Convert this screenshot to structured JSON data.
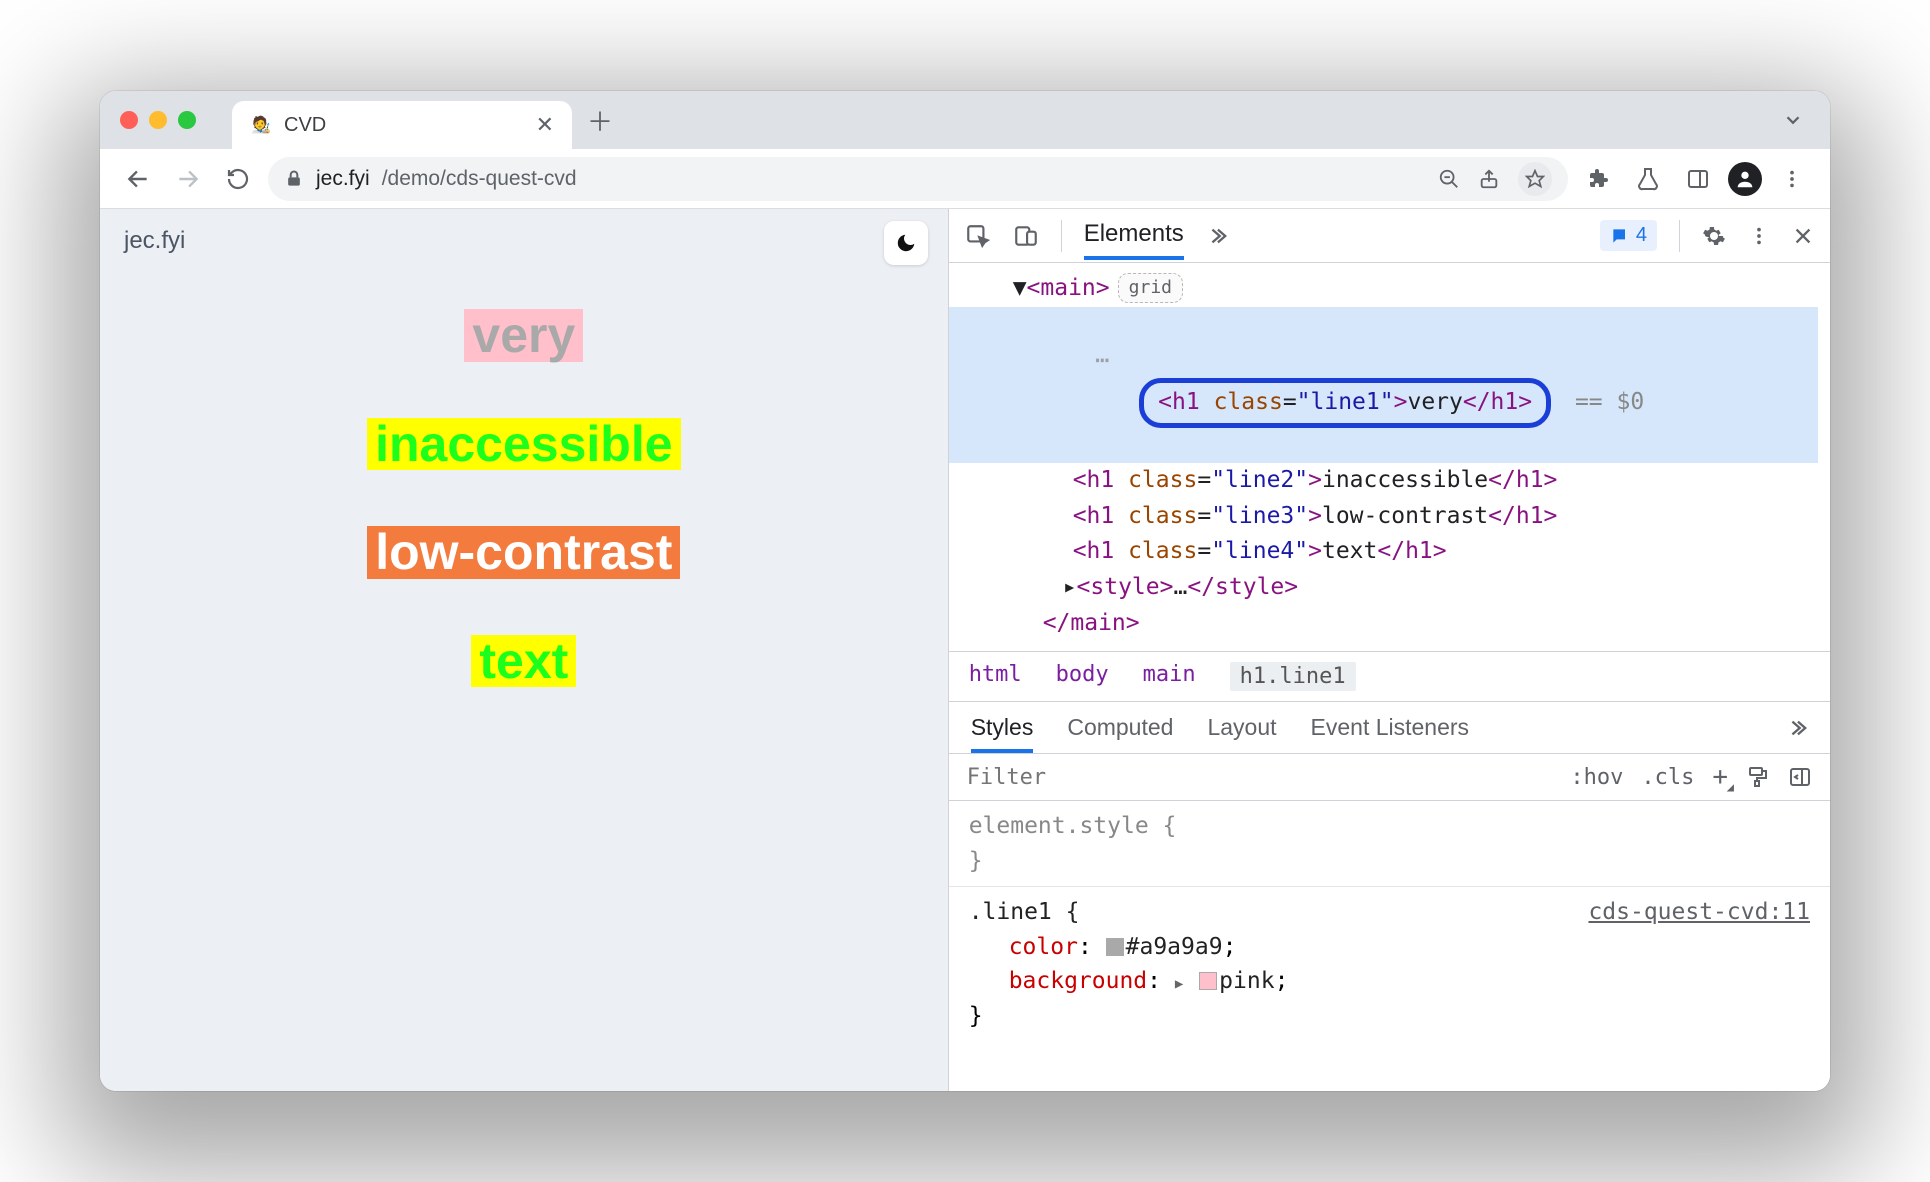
{
  "tab": {
    "title": "CVD",
    "favicon_emoji": "🧑‍🎨"
  },
  "url": {
    "host": "jec.fyi",
    "path": "/demo/cds-quest-cvd"
  },
  "page": {
    "logo": "jec.fyi",
    "lines": {
      "l1": "very",
      "l2": "inaccessible",
      "l3": "low-contrast",
      "l4": "text"
    }
  },
  "devtools": {
    "panel": "Elements",
    "issues_count": "4",
    "dom": {
      "main_open": "<main>",
      "main_badge": "grid",
      "h1_line1": {
        "open": "<h1 class=\"line1\">",
        "text": "very",
        "close": "</h1>",
        "suffix": " == $0"
      },
      "h1_line2": {
        "open": "<h1 class=\"line2\">",
        "text": "inaccessible",
        "close": "</h1>"
      },
      "h1_line3": {
        "open": "<h1 class=\"line3\">",
        "text": "low-contrast",
        "close": "</h1>"
      },
      "h1_line4": {
        "open": "<h1 class=\"line4\">",
        "text": "text",
        "close": "</h1>"
      },
      "style_open": "<style>",
      "style_ell": "…",
      "style_close": "</style>",
      "main_close": "</main>"
    },
    "crumbs": [
      "html",
      "body",
      "main",
      "h1.line1"
    ],
    "panes": [
      "Styles",
      "Computed",
      "Layout",
      "Event Listeners"
    ],
    "filter_placeholder": "Filter",
    "filter_tools": {
      "hov": ":hov",
      "cls": ".cls"
    },
    "styles": {
      "element_style_label": "element.style {",
      "rule_selector": ".line1 {",
      "rule_source": "cds-quest-cvd:11",
      "decl_color_prop": "color",
      "decl_color_val": "#a9a9a9",
      "decl_bg_prop": "background",
      "decl_bg_val": "pink"
    }
  }
}
